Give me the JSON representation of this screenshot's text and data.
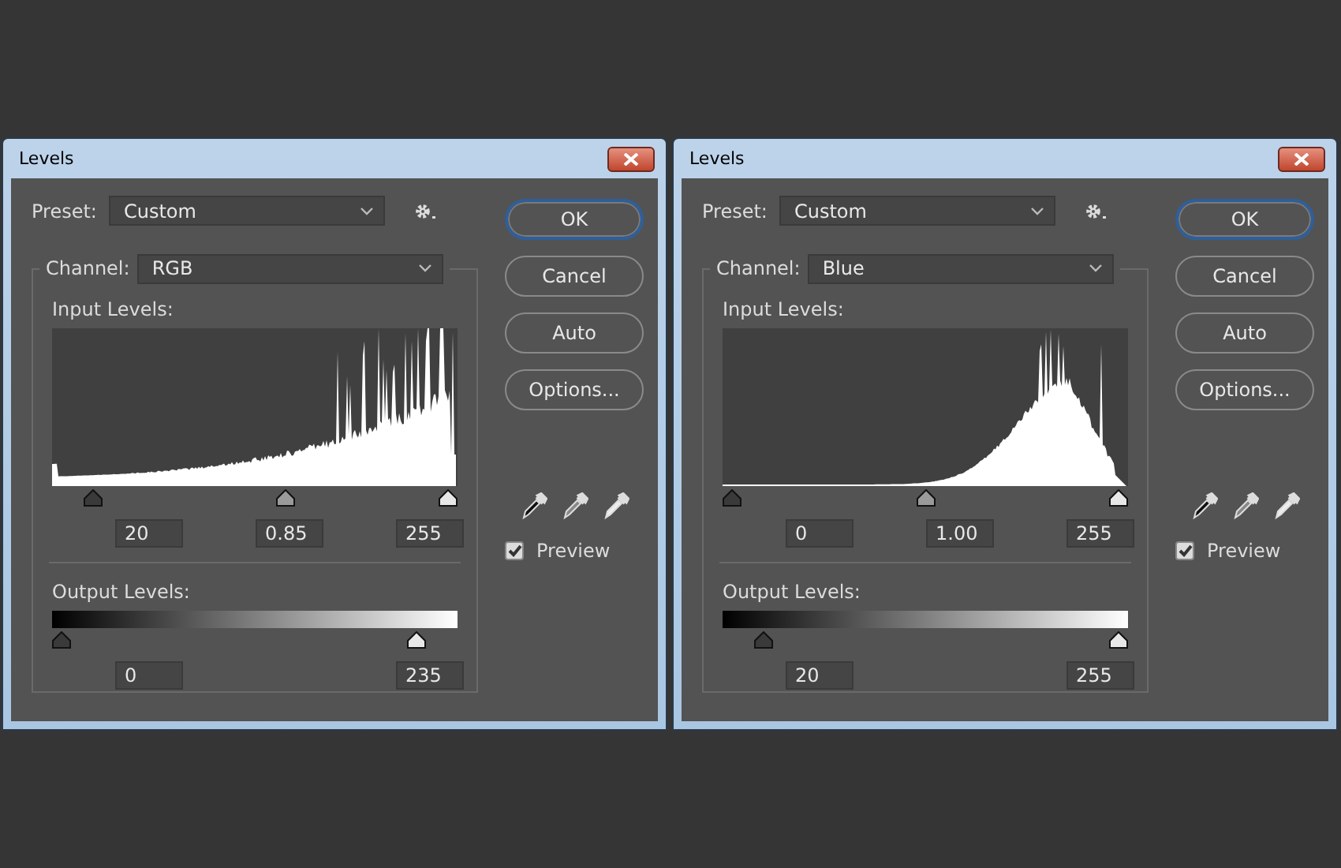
{
  "dialogs": [
    {
      "title": "Levels",
      "preset": {
        "label": "Preset:",
        "value": "Custom"
      },
      "channel": {
        "label": "Channel:",
        "value": "RGB"
      },
      "input": {
        "label": "Input Levels:",
        "handles": [
          {
            "kind": "shadow",
            "level": 0.08
          },
          {
            "kind": "midtone",
            "level": 0.58
          },
          {
            "kind": "highlight",
            "level": 1
          }
        ],
        "values": [
          "20",
          "0.85",
          "255"
        ]
      },
      "output": {
        "label": "Output Levels:",
        "handles": [
          {
            "kind": "shadow",
            "level": 0
          },
          {
            "kind": "highlight",
            "level": 0.92
          }
        ],
        "values": [
          "0",
          "235"
        ]
      },
      "buttons": [
        {
          "label": "OK",
          "default": true
        },
        {
          "label": "Cancel",
          "default": false
        },
        {
          "label": "Auto",
          "default": false
        },
        {
          "label": "Options...",
          "default": false
        }
      ],
      "preview": {
        "label": "Preview",
        "checked": true
      }
    },
    {
      "title": "Levels",
      "preset": {
        "label": "Preset:",
        "value": "Custom"
      },
      "channel": {
        "label": "Channel:",
        "value": "Blue"
      },
      "input": {
        "label": "Input Levels:",
        "handles": [
          {
            "kind": "shadow",
            "level": 0
          },
          {
            "kind": "midtone",
            "level": 0.5
          },
          {
            "kind": "highlight",
            "level": 1
          }
        ],
        "values": [
          "0",
          "1.00",
          "255"
        ]
      },
      "output": {
        "label": "Output Levels:",
        "handles": [
          {
            "kind": "shadow",
            "level": 0.08
          },
          {
            "kind": "highlight",
            "level": 1
          }
        ],
        "values": [
          "20",
          "255"
        ]
      },
      "buttons": [
        {
          "label": "OK",
          "default": true
        },
        {
          "label": "Cancel",
          "default": false
        },
        {
          "label": "Auto",
          "default": false
        },
        {
          "label": "Options...",
          "default": false
        }
      ],
      "preview": {
        "label": "Preview",
        "checked": true
      }
    }
  ]
}
